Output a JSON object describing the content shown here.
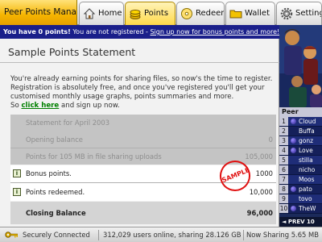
{
  "app": {
    "title": "Peer Points Manager"
  },
  "tabs": [
    {
      "label": "Home",
      "icon": "house-icon"
    },
    {
      "label": "Points",
      "icon": "coins-icon",
      "active": true
    },
    {
      "label": "Redeem",
      "icon": "cd-icon"
    },
    {
      "label": "Wallet",
      "icon": "folder-icon"
    },
    {
      "label": "Settings",
      "icon": "gear-icon"
    }
  ],
  "notice": {
    "bold": "You have 0 points!",
    "text": " You are not registered - ",
    "link": "Sign up now for bonus points and more!"
  },
  "page": {
    "title": "Sample Points Statement",
    "intro_text": "You're already earning points for sharing files, so now's the time to register. Registration is absolutely free, and once you've registered you'll get your customised monthly usage graphs, points summaries and more.",
    "intro_so": "So ",
    "intro_link": "click here",
    "intro_end": " and sign up now."
  },
  "statement": {
    "header": "Statement for April 2003",
    "stamp": "SAMPLE",
    "rows": [
      {
        "label": "Opening balance",
        "value": "0"
      },
      {
        "label": "Points for 105 MB in file sharing uploads",
        "value": "105,000"
      },
      {
        "label": "Bonus points.",
        "value": "1000"
      },
      {
        "label": "Points redeemed.",
        "value": "10,000"
      }
    ],
    "closing": {
      "label": "Closing Balance",
      "value": "96,000"
    }
  },
  "sidebar": {
    "header": "Peer",
    "peers": [
      {
        "num": "1",
        "name": "Cloud"
      },
      {
        "num": "2",
        "name": "Buffa"
      },
      {
        "num": "3",
        "name": "gonz"
      },
      {
        "num": "4",
        "name": "Love"
      },
      {
        "num": "5",
        "name": "stilla"
      },
      {
        "num": "6",
        "name": "nicho"
      },
      {
        "num": "7",
        "name": "Moos"
      },
      {
        "num": "8",
        "name": "pato"
      },
      {
        "num": "9",
        "name": "tovo"
      },
      {
        "num": "10",
        "name": "TheW"
      }
    ],
    "nav": "◄ PREV 10"
  },
  "status": {
    "connection": "Securely Connected",
    "users": "312,029 users online, sharing 28.126 GB",
    "now": "Now Sharing 5.65 MB"
  },
  "colors": {
    "accent": "#f5b400",
    "notice_bg": "#1a1f8a",
    "link_green": "#008000",
    "stamp_red": "#e01010"
  }
}
